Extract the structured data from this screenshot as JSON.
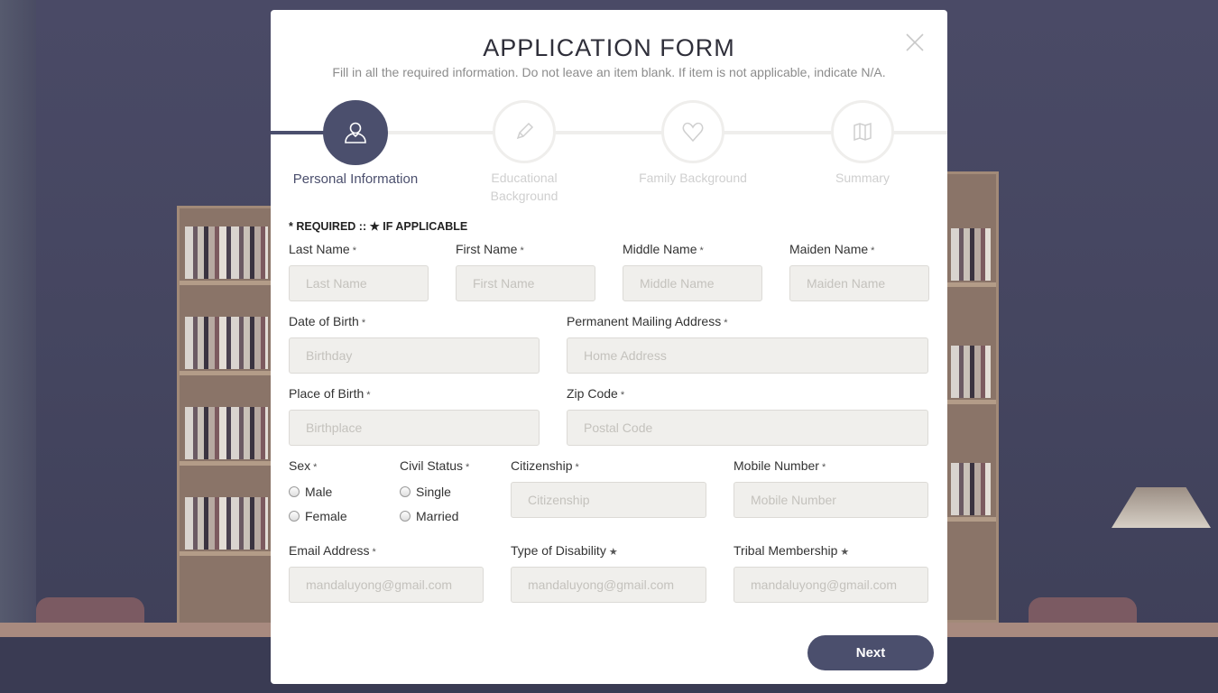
{
  "form": {
    "title": "APPLICATION FORM",
    "subtitle": "Fill in all the required information. Do not leave an item blank. If item is not applicable, indicate N/A.",
    "legend": "* REQUIRED :: ★ IF APPLICABLE"
  },
  "icons": {
    "close": "close-icon",
    "personal": "user-icon",
    "educational": "pencil-icon",
    "family": "heart-icon",
    "summary": "map-icon"
  },
  "steps": [
    {
      "label": "Personal Information",
      "active": true
    },
    {
      "label": "Educational Background",
      "active": false
    },
    {
      "label": "Family Background",
      "active": false
    },
    {
      "label": "Summary",
      "active": false
    }
  ],
  "markers": {
    "required": "*",
    "applicable": "★"
  },
  "fields": {
    "last_name": {
      "label": "Last Name",
      "placeholder": "Last Name",
      "value": ""
    },
    "first_name": {
      "label": "First Name",
      "placeholder": "First Name",
      "value": ""
    },
    "middle_name": {
      "label": "Middle Name",
      "placeholder": "Middle Name",
      "value": ""
    },
    "maiden_name": {
      "label": "Maiden Name",
      "placeholder": "Maiden Name",
      "value": ""
    },
    "dob": {
      "label": "Date of Birth",
      "placeholder": "Birthday",
      "value": ""
    },
    "address": {
      "label": "Permanent Mailing Address",
      "placeholder": "Home Address",
      "value": ""
    },
    "pob": {
      "label": "Place of Birth",
      "placeholder": "Birthplace",
      "value": ""
    },
    "zip": {
      "label": "Zip Code",
      "placeholder": "Postal Code",
      "value": ""
    },
    "sex": {
      "label": "Sex",
      "options": [
        "Male",
        "Female"
      ]
    },
    "civil": {
      "label": "Civil Status",
      "options": [
        "Single",
        "Married"
      ]
    },
    "citizenship": {
      "label": "Citizenship",
      "placeholder": "Citizenship",
      "value": ""
    },
    "mobile": {
      "label": "Mobile Number",
      "placeholder": "Mobile Number",
      "value": ""
    },
    "email": {
      "label": "Email Address",
      "placeholder": "mandaluyong@gmail.com",
      "value": ""
    },
    "disability": {
      "label": "Type of Disability",
      "placeholder": "mandaluyong@gmail.com",
      "value": ""
    },
    "tribal": {
      "label": "Tribal Membership",
      "placeholder": "mandaluyong@gmail.com",
      "value": ""
    }
  },
  "actions": {
    "next_label": "Next"
  },
  "colors": {
    "accent": "#4b4f6d",
    "input_bg": "#f0efec",
    "inactive": "#cfcfcf"
  }
}
